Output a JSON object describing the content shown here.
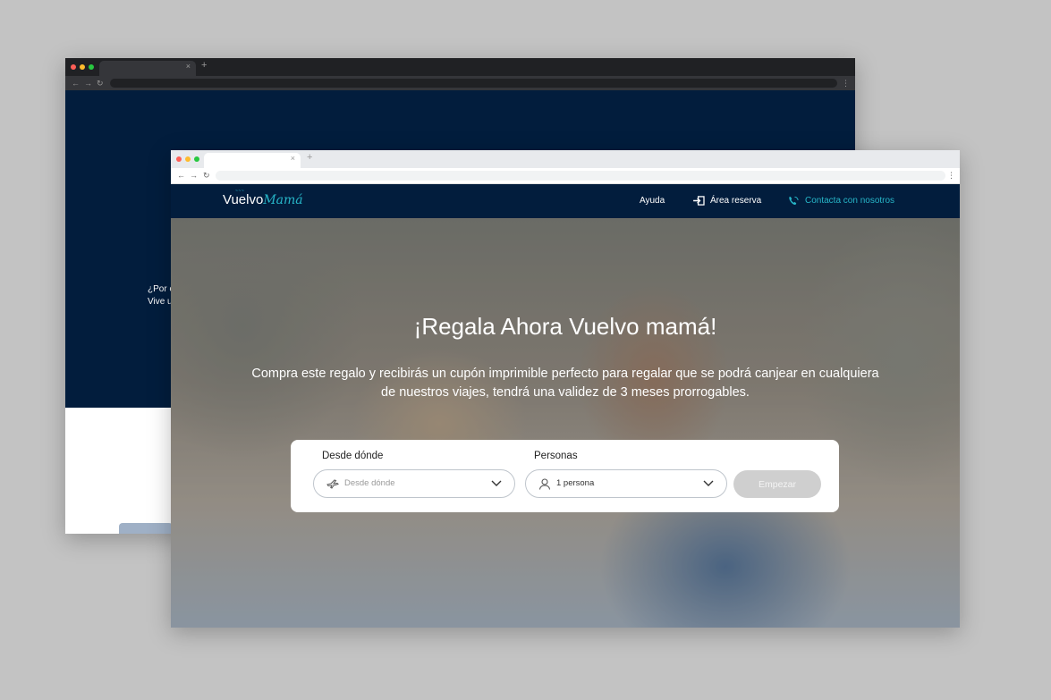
{
  "back_window": {
    "snippet_line1": "¿Por c",
    "snippet_line2": "Vive u"
  },
  "browser": {
    "tab_close": "×",
    "tab_plus": "+"
  },
  "site": {
    "logo_main": "Vuelvo",
    "logo_accent": "Mamá",
    "nav": {
      "help": "Ayuda",
      "reservation": "Área reserva",
      "contact": "Contacta con nosotros"
    }
  },
  "hero": {
    "title": "¡Regala Ahora Vuelvo mamá!",
    "subtitle": "Compra este regalo y recibirás un cupón imprimible perfecto para regalar que se podrá canjear en cualquiera de nuestros viajes, tendrá una validez de 3 meses prorrogables."
  },
  "search": {
    "origin_label": "Desde dónde",
    "origin_placeholder": "Desde dónde",
    "people_label": "Personas",
    "people_value": "1 persona",
    "start_button": "Empezar"
  },
  "colors": {
    "navy": "#021d3d",
    "accent": "#27b6c8",
    "button_disabled": "#cfcfcf"
  }
}
